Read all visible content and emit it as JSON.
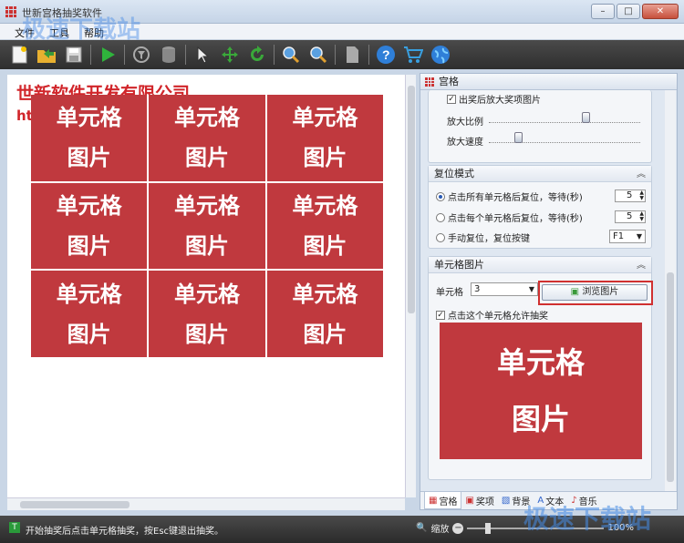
{
  "window": {
    "title": "世新宫格抽奖软件",
    "min": "–",
    "max": "□",
    "close": "✕"
  },
  "menu": [
    "文件",
    "工具",
    "帮助"
  ],
  "toolbar": {
    "icons": [
      "new-file-icon",
      "open-folder-icon",
      "save-icon",
      "play-icon",
      "filter-icon",
      "database-icon",
      "pointer-icon",
      "move-icon",
      "refresh-icon",
      "zoom-in-icon",
      "zoom-fit-icon",
      "page-icon",
      "help-icon",
      "cart-icon",
      "globe-icon"
    ]
  },
  "canvas": {
    "company": "世新软件开发有限公司",
    "company_url": "ht",
    "cells": [
      {
        "line1": "单元格",
        "line2": "图片"
      },
      {
        "line1": "单元格",
        "line2": "图片"
      },
      {
        "line1": "单元格",
        "line2": "图片"
      },
      {
        "line1": "单元格",
        "line2": "图片"
      },
      {
        "line1": "单元格",
        "line2": "图片"
      },
      {
        "line1": "单元格",
        "line2": "图片"
      },
      {
        "line1": "单元格",
        "line2": "图片"
      },
      {
        "line1": "单元格",
        "line2": "图片"
      },
      {
        "line1": "单元格",
        "line2": "图片"
      }
    ]
  },
  "panel": {
    "title": "宫格",
    "zoom_section": {
      "enlarge_after_win": "出奖后放大奖项图片",
      "enlarge_ratio": "放大比例",
      "enlarge_speed": "放大速度",
      "ratio_level": 0.65,
      "speed_level": 0.18
    },
    "reset_section": {
      "title": "复位模式",
      "opt_all": "点击所有单元格后复位，等待(秒)",
      "opt_each": "点击每个单元格后复位，等待(秒)",
      "opt_manual": "手动复位，复位按键",
      "wait_all": "5",
      "wait_each": "5",
      "reset_key": "F1"
    },
    "cell_section": {
      "title": "单元格图片",
      "cell_label": "单元格",
      "cell_value": "3",
      "browse": "浏览图片",
      "allow_draw": "点击这个单元格允许抽奖",
      "preview_line1": "单元格",
      "preview_line2": "图片"
    },
    "tabs": [
      "宫格",
      "奖项",
      "背景",
      "文本",
      "音乐"
    ]
  },
  "status": {
    "text": "开始抽奖后点击单元格抽奖，按Esc键退出抽奖。",
    "zoom_label": "缩放",
    "zoom_value": "100%"
  },
  "watermark": {
    "top_left": "极速下载站",
    "bottom_right": "极速下载站"
  }
}
